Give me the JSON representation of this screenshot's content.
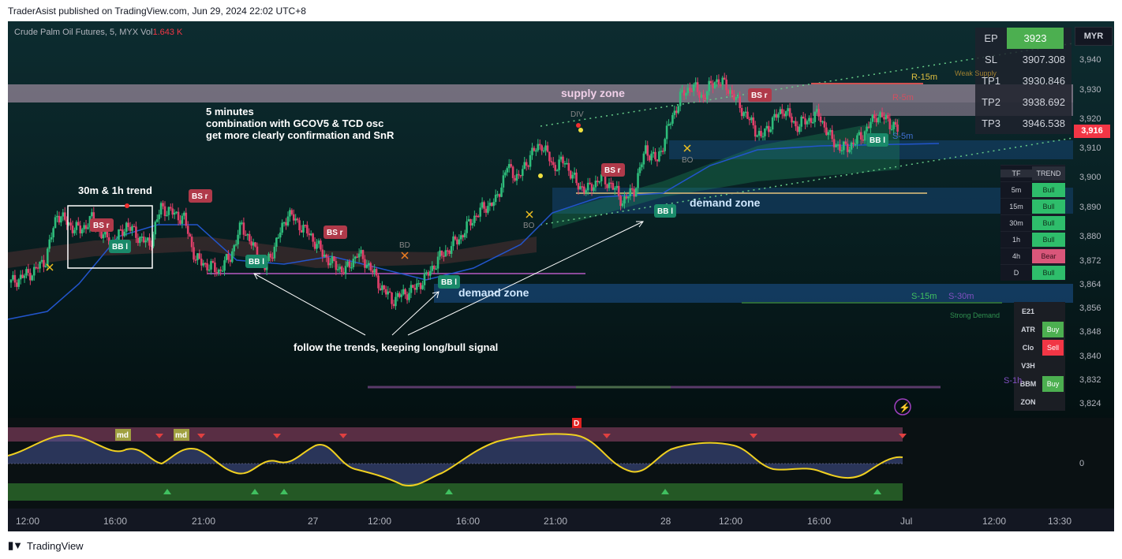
{
  "publisher_line": "TraderAsist published on TradingView.com, Jun 29, 2024 22:02 UTC+8",
  "footer_brand": "TradingView",
  "symbol": {
    "name": "Crude Palm Oil Futures, 5, MYX",
    "vol_label": "Vol",
    "vol_value": "1.643 K"
  },
  "currency_badge": "MYR",
  "current_price": "3,916",
  "price_axis_labels": [
    "3,940",
    "3,930",
    "3,920",
    "3,910",
    "3,900",
    "3,890",
    "3,880",
    "3,872",
    "3,864",
    "3,856",
    "3,848",
    "3,840",
    "3,832",
    "3,824"
  ],
  "time_axis_labels": [
    "12:00",
    "16:00",
    "21:00",
    "27",
    "12:00",
    "16:00",
    "21:00",
    "28",
    "12:00",
    "16:00",
    "Jul",
    "12:00",
    "13:30"
  ],
  "oscillator_zero_label": "0",
  "ep_table": [
    {
      "key": "EP",
      "value": "3923"
    },
    {
      "key": "SL",
      "value": "3907.308"
    },
    {
      "key": "TP1",
      "value": "3930.846"
    },
    {
      "key": "TP2",
      "value": "3938.692"
    },
    {
      "key": "TP3",
      "value": "3946.538"
    }
  ],
  "trend_table": {
    "headers": [
      "TF",
      "TREND"
    ],
    "rows": [
      {
        "tf": "5m",
        "trend": "Bull"
      },
      {
        "tf": "15m",
        "trend": "Bull"
      },
      {
        "tf": "30m",
        "trend": "Bull"
      },
      {
        "tf": "1h",
        "trend": "Bull"
      },
      {
        "tf": "4h",
        "trend": "Bear"
      },
      {
        "tf": "D",
        "trend": "Bull"
      }
    ]
  },
  "indicator_table": [
    {
      "key": "E21",
      "value": ""
    },
    {
      "key": "ATR",
      "value": "Buy"
    },
    {
      "key": "Clo",
      "value": "Sell"
    },
    {
      "key": "V3H",
      "value": ""
    },
    {
      "key": "BBM",
      "value": "Buy"
    },
    {
      "key": "ZON",
      "value": ""
    }
  ],
  "zone_labels": {
    "supply": "supply zone",
    "demand_upper": "demand zone",
    "demand_lower": "demand zone"
  },
  "level_labels": {
    "r15": "R-15m",
    "weak_supply": "Weak Supply",
    "r5": "R-5m",
    "s5": "S-5m",
    "s15": "S-15m",
    "s30": "S-30m",
    "strong_demand": "Strong Demand",
    "s1h": "S-1h"
  },
  "annotations": {
    "title_block": [
      "5 minutes",
      "combination with GCOV5 & TCD osc",
      "get more clearly confirmation and SnR"
    ],
    "trend_box": "30m & 1h trend",
    "follow": "follow the trends, keeping long/bull signal"
  },
  "signal_labels": {
    "bsr": "BS r",
    "bbl": "BB l",
    "div": "DIV",
    "bo": "BO",
    "bd": "BD",
    "md": "md",
    "d": "D"
  },
  "colors": {
    "bull": "#26a69a",
    "bear": "#ef5350",
    "accent_green": "#4caf50",
    "accent_red": "#f23645"
  },
  "chart_data": {
    "type": "candlestick",
    "symbol": "Crude Palm Oil Futures, 5, MYX",
    "ylim": [
      3820,
      3948
    ],
    "y_ticks": [
      3940,
      3930,
      3920,
      3910,
      3900,
      3890,
      3880,
      3872,
      3864,
      3856,
      3848,
      3840,
      3832,
      3824
    ],
    "x_ticks": [
      "12:00",
      "16:00",
      "21:00",
      "27",
      "12:00",
      "16:00",
      "21:00",
      "28",
      "12:00",
      "16:00",
      "Jul",
      "12:00",
      "13:30"
    ],
    "close_path": [
      3864,
      3866,
      3868,
      3872,
      3888,
      3884,
      3882,
      3886,
      3880,
      3878,
      3884,
      3880,
      3877,
      3890,
      3888,
      3886,
      3872,
      3870,
      3868,
      3873,
      3884,
      3876,
      3869,
      3878,
      3888,
      3884,
      3880,
      3874,
      3870,
      3868,
      3874,
      3870,
      3863,
      3858,
      3860,
      3862,
      3866,
      3872,
      3876,
      3880,
      3886,
      3890,
      3892,
      3904,
      3900,
      3908,
      3912,
      3904,
      3906,
      3898,
      3896,
      3900,
      3898,
      3892,
      3896,
      3910,
      3906,
      3918,
      3928,
      3932,
      3928,
      3934,
      3932,
      3926,
      3920,
      3914,
      3920,
      3924,
      3918,
      3920,
      3922,
      3914,
      3910,
      3912,
      3916,
      3922,
      3920,
      3916
    ],
    "zones": [
      {
        "name": "supply zone",
        "from": 3928,
        "to": 3932
      },
      {
        "name": "demand zone",
        "from": 3888,
        "to": 3896
      },
      {
        "name": "demand zone",
        "from": 3856,
        "to": 3863
      }
    ]
  }
}
